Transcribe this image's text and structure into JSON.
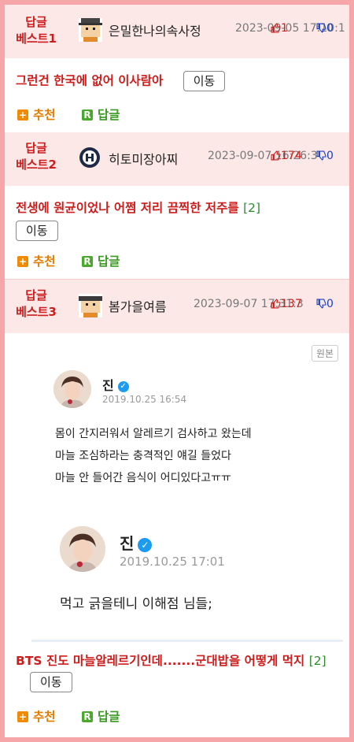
{
  "best": [
    {
      "label_line1": "답글",
      "label_line2": "베스트1",
      "nickname": "은밀한나의속사정",
      "date": "2023-09-05 17:10:1",
      "up": "1",
      "down": "0",
      "title": "그런건 한국에 없어 이사람아",
      "count": "",
      "move_label": "이동",
      "recommend_label": "추천",
      "reply_label": "답글"
    },
    {
      "label_line1": "답글",
      "label_line2": "베스트2",
      "nickname": "히토미장아찌",
      "date": "2023-09-07 16:26:3",
      "up": "174",
      "down": "0",
      "title": "전생에 원균이었나 어쩜 저리 끔찍한 저주를",
      "count": "[2]",
      "move_label": "이동",
      "recommend_label": "추천",
      "reply_label": "답글"
    },
    {
      "label_line1": "답글",
      "label_line2": "베스트3",
      "nickname": "봄가을여름",
      "date": "2023-09-07 17:31:3",
      "up": "137",
      "down": "0",
      "title": "BTS 진도 마늘알레르기인데.......군대밥을 어떻게 먹지",
      "count": "[2]",
      "move_label": "이동",
      "recommend_label": "추천",
      "reply_label": "답글"
    }
  ],
  "embed": {
    "original_label": "원본",
    "tweet1": {
      "name": "진",
      "date": "2019.10.25 16:54",
      "lines": [
        "몸이 간지러워서 알레르기 검사하고 왔는데",
        "마늘 조심하라는 충격적인 얘길 들었다",
        "마늘 안 들어간 음식이 어디있다고ㅠㅠ"
      ]
    },
    "tweet2": {
      "name": "진",
      "date": "2019.10.25 17:01",
      "lines": [
        "먹고 긁을테니 이해점 님들;"
      ]
    }
  },
  "colors": {
    "border": "#f6a5a8",
    "header_bg": "#fde8e8",
    "best_label": "#cc1c1c",
    "upvote": "#cc1c1c",
    "downvote": "#1a3dbd",
    "recommend": "#e07c00",
    "reply": "#3a9a22",
    "verified": "#1d9bf0"
  },
  "icons": {
    "avatar1": "pixel-character-icon",
    "avatar2": "circle-logo-icon",
    "avatar3": "pixel-character-icon",
    "upvote": "thumbs-up-icon",
    "downvote": "thumbs-down-icon",
    "recommend": "plus-icon",
    "reply": "reply-r-icon",
    "verified": "verified-badge-icon"
  }
}
